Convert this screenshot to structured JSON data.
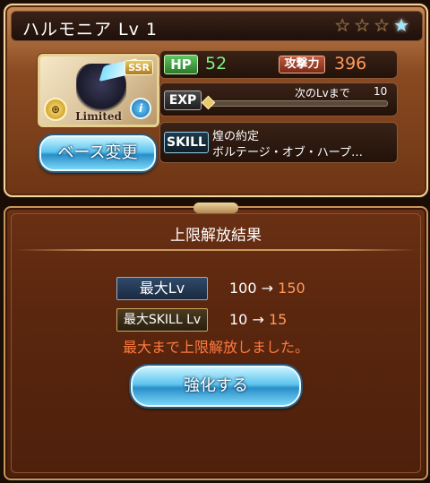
{
  "card": {
    "title": "ハルモニア Lv 1",
    "stars": [
      "☆",
      "☆",
      "☆",
      "★"
    ],
    "portrait": {
      "rarity": "SSR",
      "badge": "Limited",
      "coin_icon": "gold-coin-icon",
      "info_icon": "info-icon"
    },
    "base_change_label": "ベース変更",
    "hp_label": "HP",
    "hp_value": "52",
    "atk_label": "攻撃力",
    "atk_value": "396",
    "exp_label": "EXP",
    "next_label": "次のLvまで",
    "next_value": "10",
    "exp_progress": 0,
    "skill_label": "SKILL",
    "skill_line1": "煌の約定",
    "skill_line2": "ボルテージ・オブ・ハープ…"
  },
  "result": {
    "title": "上限解放結果",
    "max_lv_label": "最大Lv",
    "max_lv_from": "100",
    "max_lv_arrow": "→",
    "max_lv_to": "150",
    "max_skill_label": "最大SKILL Lv",
    "max_skill_from": "10",
    "max_skill_arrow": "→",
    "max_skill_to": "15",
    "message": "最大まで上限解放しました。",
    "enhance_label": "強化する"
  },
  "colors": {
    "stat_green": "#7ef27e",
    "stat_orange": "#ff9a5a",
    "message": "#ff7a40",
    "button_blue": "#5ec4ee"
  }
}
